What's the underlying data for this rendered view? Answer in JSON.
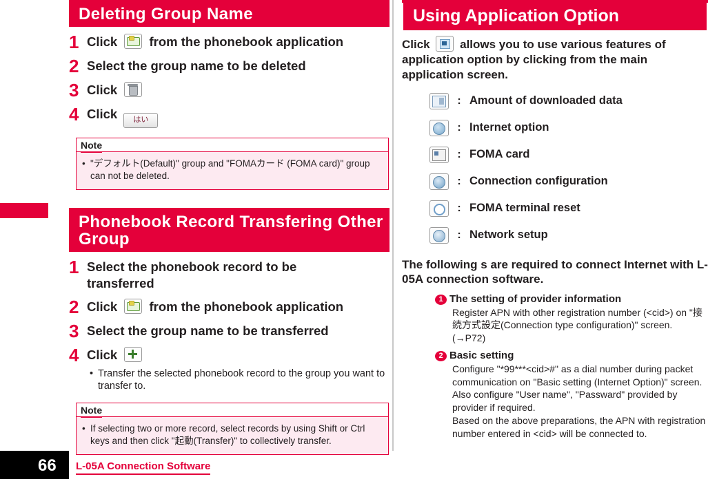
{
  "left": {
    "section1": {
      "title": "Deleting Group Name",
      "steps": [
        {
          "num": "1",
          "pre": "Click",
          "icon": "group-icon",
          "post": "from the phonebook application"
        },
        {
          "num": "2",
          "pre": "Select the group name to be deleted",
          "icon": "",
          "post": ""
        },
        {
          "num": "3",
          "pre": "Click",
          "icon": "trash-icon",
          "post": ""
        },
        {
          "num": "4",
          "pre": "Click",
          "icon": "yes-button",
          "post": "",
          "button_label": "はい"
        }
      ],
      "note": {
        "label": "Note",
        "bullets": [
          "\"デフォルト(Default)\" group and \"FOMAカード (FOMA card)\" group can not be deleted."
        ]
      }
    },
    "section2": {
      "title": "Phonebook Record Transfering Other Group",
      "steps": [
        {
          "num": "1",
          "pre": "Select the phonebook record to be transferred",
          "icon": "",
          "post": ""
        },
        {
          "num": "2",
          "pre": "Click",
          "icon": "group-icon",
          "post": "from the phonebook application"
        },
        {
          "num": "3",
          "pre": "Select the group name to be transferred",
          "icon": "",
          "post": ""
        },
        {
          "num": "4",
          "pre": "Click",
          "icon": "plus-icon",
          "post": ""
        }
      ],
      "step_bullets": [
        "Transfer the selected phonebook record to the group you want to transfer to."
      ],
      "note": {
        "label": "Note",
        "bullets": [
          "If selecting two or more record, select records by using Shift or Ctrl keys and then click \"起動(Transfer)\" to collectively transfer."
        ]
      }
    }
  },
  "right": {
    "title": "Using Application Option",
    "intro_pre": "Click",
    "intro_icon": "application-option-icon",
    "intro_post": "allows you to use various features of application option by clicking from the main application screen.",
    "options": [
      {
        "icon": "downloaded-data-icon",
        "colon": ":",
        "label": "Amount of downloaded data"
      },
      {
        "icon": "internet-option-icon",
        "colon": ":",
        "label": "Internet option"
      },
      {
        "icon": "foma-card-icon",
        "colon": ":",
        "label": "FOMA card"
      },
      {
        "icon": "connection-configuration-icon",
        "colon": ":",
        "label": "Connection configuration"
      },
      {
        "icon": "foma-terminal-reset-icon",
        "colon": ":",
        "label": "FOMA terminal reset"
      },
      {
        "icon": "network-setup-icon",
        "colon": ":",
        "label": "Network setup"
      }
    ],
    "body_lead": "The following s are required to connect Internet with L-05A connection software.",
    "enumerated": [
      {
        "num": "1",
        "heading": "The setting of provider information",
        "body": "Register APN with other registration number (<cid>) on \"接続方式設定(Connection type configuration)\" screen. (→P72)"
      },
      {
        "num": "2",
        "heading": "Basic setting",
        "body": "Configure \"*99***<cid>#\" as a dial number during packet communication on \"Basic setting (Internet Option)\" screen. Also configure \"User name\", \"Passward\" provided by provider if required.\nBased on the above preparations, the APN with registration number entered in <cid> will be connected to."
      }
    ]
  },
  "footer": {
    "page_number": "66",
    "title": "L-05A Connection Software"
  },
  "colors": {
    "accent": "#e4003a",
    "note_bg": "#fdeaf1",
    "text": "#231f20"
  }
}
